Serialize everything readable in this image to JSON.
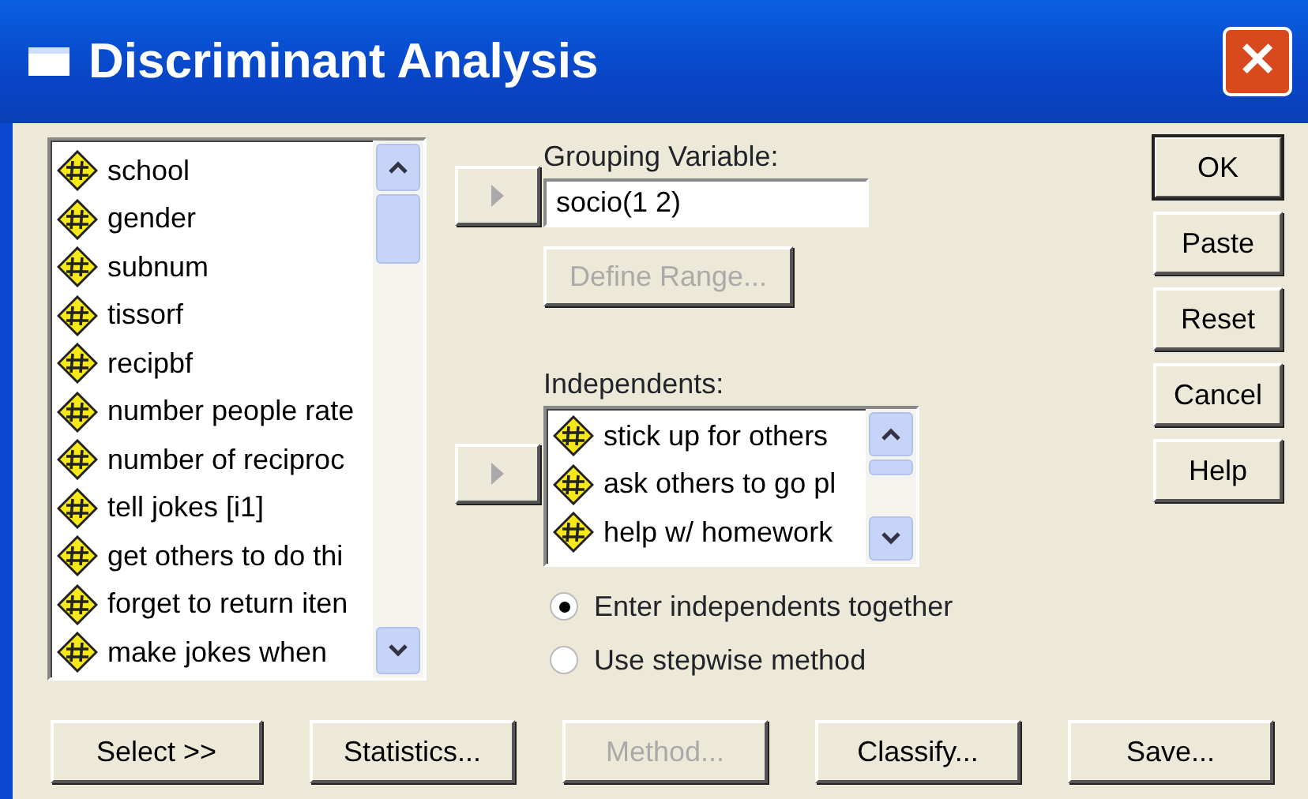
{
  "window": {
    "title": "Discriminant Analysis",
    "close": "✕"
  },
  "variables": {
    "items": [
      {
        "label": "school"
      },
      {
        "label": "gender"
      },
      {
        "label": "subnum"
      },
      {
        "label": "tissorf"
      },
      {
        "label": "recipbf"
      },
      {
        "label": "number people rate"
      },
      {
        "label": "number of reciproc"
      },
      {
        "label": "tell jokes [i1]"
      },
      {
        "label": "get others to do thi"
      },
      {
        "label": "forget to return iten"
      },
      {
        "label": "make jokes when "
      }
    ]
  },
  "grouping": {
    "label": "Grouping Variable:",
    "value": "socio(1 2)",
    "define_range": {
      "label": "Define Range...",
      "disabled": true
    }
  },
  "independents": {
    "label": "Independents:",
    "items": [
      {
        "label": "stick up for others"
      },
      {
        "label": "ask others to go pl"
      },
      {
        "label": "help w/ homework"
      }
    ]
  },
  "method_options": [
    {
      "label": "Enter independents together",
      "selected": true
    },
    {
      "label": "Use stepwise method",
      "selected": false
    }
  ],
  "side_buttons": [
    {
      "label": "OK",
      "default": true
    },
    {
      "label": "Paste",
      "default": false
    },
    {
      "label": "Reset",
      "default": false
    },
    {
      "label": "Cancel",
      "default": false
    },
    {
      "label": "Help",
      "default": false
    }
  ],
  "bottom_buttons": [
    {
      "label": "Select >>",
      "disabled": false
    },
    {
      "label": "Statistics...",
      "disabled": false
    },
    {
      "label": "Method...",
      "disabled": true
    },
    {
      "label": "Classify...",
      "disabled": false
    },
    {
      "label": "Save...",
      "disabled": false
    }
  ]
}
